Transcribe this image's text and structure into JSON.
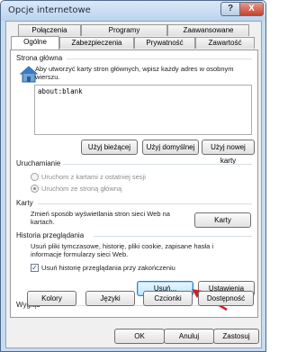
{
  "window": {
    "title": "Opcje internetowe",
    "help_label": "?",
    "close_label": "X"
  },
  "tabs_row1": [
    "Połączenia",
    "Programy",
    "Zaawansowane"
  ],
  "tabs_row2": [
    "Ogólne",
    "Zabezpieczenia",
    "Prywatność",
    "Zawartość"
  ],
  "home": {
    "group_title": "Strona główna",
    "description": "Aby utworzyć karty stron głównych, wpisz każdy adres w osobnym wierszu.",
    "url_value": "about:blank",
    "btn_current": "Użyj bieżącej",
    "btn_default": "Użyj domyślnej",
    "btn_new_tab": "Użyj nowej karty"
  },
  "startup": {
    "group_title": "Uruchamianie",
    "opt_last_session": "Uruchom z kartami z ostatniej sesji",
    "opt_home_page": "Uruchom ze stroną główną",
    "selected": "opt_home_page"
  },
  "tabs_group": {
    "group_title": "Karty",
    "description": "Zmień sposób wyświetlania stron sieci Web na kartach.",
    "btn": "Karty"
  },
  "history": {
    "group_title": "Historia przeglądania",
    "description": "Usuń pliki tymczasowe, historię, pliki cookie, zapisane hasła i informacje formularzy sieci Web.",
    "checkbox_label": "Usuń historię przeglądania przy zakończeniu",
    "checkbox_checked": true,
    "btn_delete": "Usuń...",
    "btn_settings": "Ustawienia"
  },
  "appearance": {
    "group_title": "Wygląd",
    "btn_colors": "Kolory",
    "btn_languages": "Języki",
    "btn_fonts": "Czcionki",
    "btn_accessibility": "Dostępność"
  },
  "footer": {
    "ok": "OK",
    "cancel": "Anuluj",
    "apply": "Zastosuj"
  },
  "colors": {
    "annotation_arrow": "#d01e2a",
    "focus_button_border": "#3c7fb1"
  }
}
